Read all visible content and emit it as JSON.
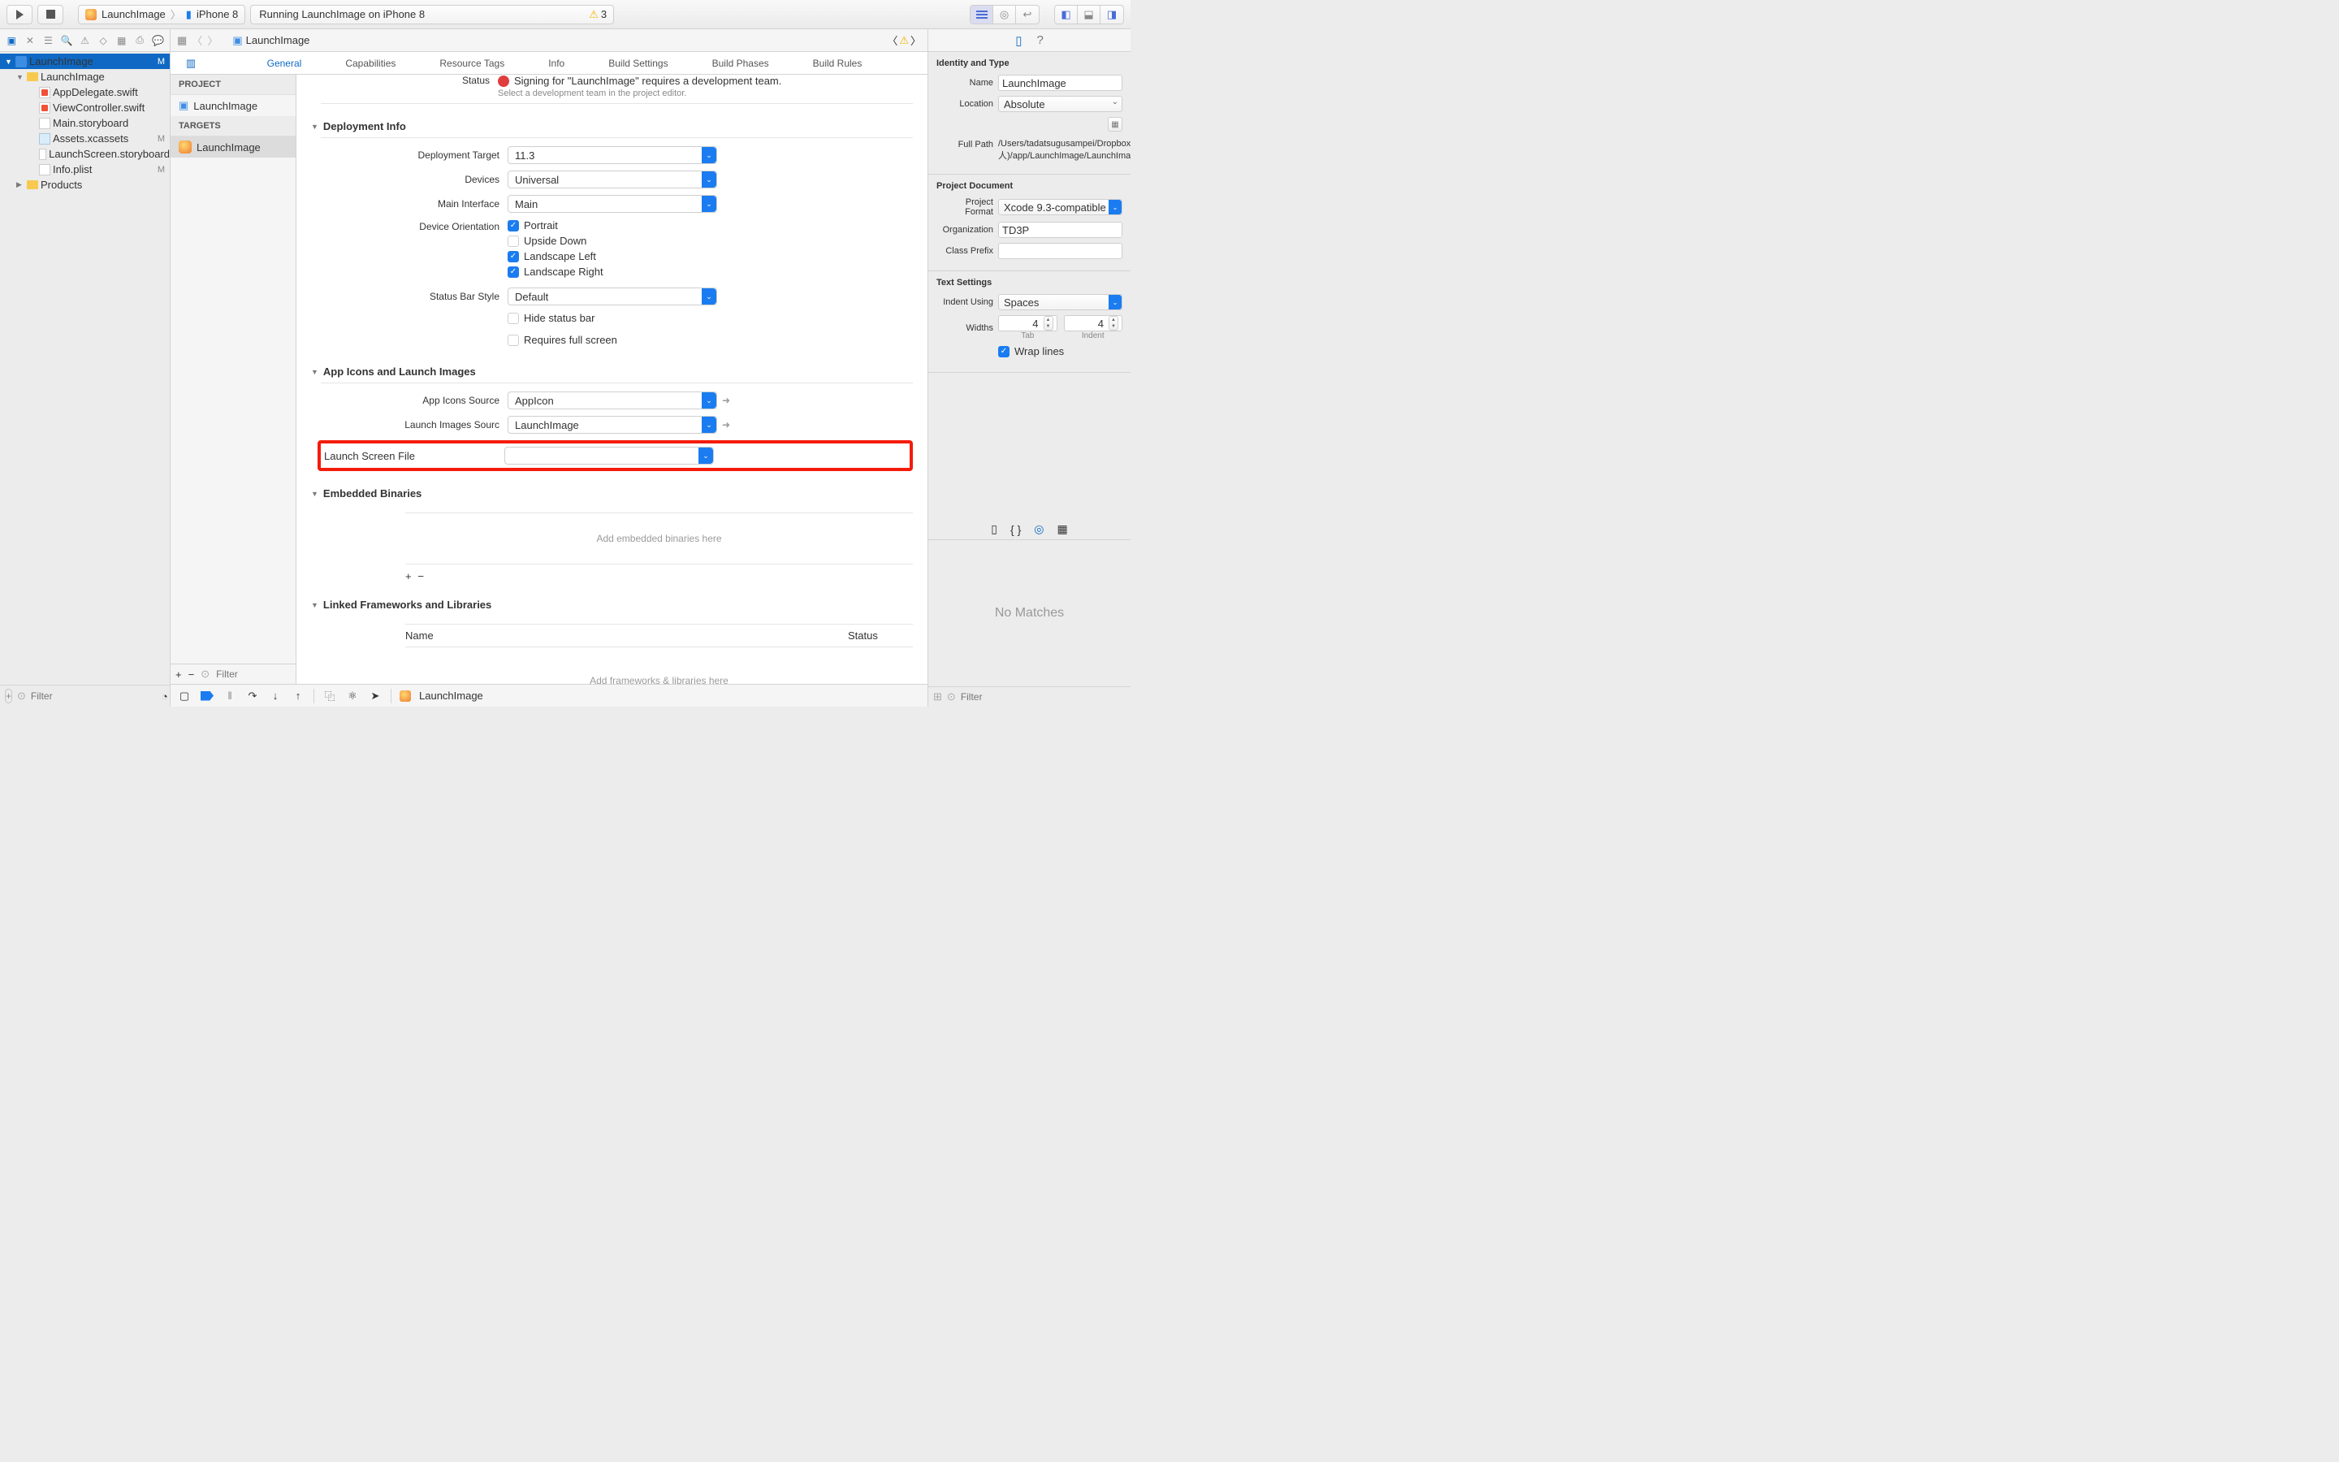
{
  "toolbar": {
    "scheme_app": "LaunchImage",
    "scheme_device": "iPhone 8",
    "activity_text": "Running LaunchImage on iPhone 8",
    "warning_count": "3"
  },
  "breadcrumb": {
    "item": "LaunchImage"
  },
  "navigator": {
    "root": "LaunchImage",
    "root_status": "M",
    "folder": "LaunchImage",
    "files": {
      "appdelegate": "AppDelegate.swift",
      "viewcontroller": "ViewController.swift",
      "mainsb": "Main.storyboard",
      "assets": "Assets.xcassets",
      "assets_status": "M",
      "launchsb": "LaunchScreen.storyboard",
      "plist": "Info.plist",
      "plist_status": "M"
    },
    "products": "Products",
    "filter_placeholder": "Filter"
  },
  "targets_panel": {
    "project_header": "PROJECT",
    "project_name": "LaunchImage",
    "targets_header": "TARGETS",
    "target_name": "LaunchImage",
    "filter_placeholder": "Filter"
  },
  "editor_tabs": {
    "general": "General",
    "capabilities": "Capabilities",
    "resource_tags": "Resource Tags",
    "info": "Info",
    "build_settings": "Build Settings",
    "build_phases": "Build Phases",
    "build_rules": "Build Rules"
  },
  "signing": {
    "status_label": "Status",
    "error_text": "Signing for \"LaunchImage\" requires a development team.",
    "hint_text": "Select a development team in the project editor."
  },
  "deployment": {
    "header": "Deployment Info",
    "target_label": "Deployment Target",
    "target_value": "11.3",
    "devices_label": "Devices",
    "devices_value": "Universal",
    "main_interface_label": "Main Interface",
    "main_interface_value": "Main",
    "orientation_label": "Device Orientation",
    "orientation": {
      "portrait": "Portrait",
      "upside_down": "Upside Down",
      "landscape_left": "Landscape Left",
      "landscape_right": "Landscape Right"
    },
    "status_bar_label": "Status Bar Style",
    "status_bar_value": "Default",
    "hide_status_bar": "Hide status bar",
    "requires_full_screen": "Requires full screen"
  },
  "app_icons": {
    "header": "App Icons and Launch Images",
    "icons_label": "App Icons Source",
    "icons_value": "AppIcon",
    "launch_images_label": "Launch Images Sourc",
    "launch_images_value": "LaunchImage",
    "launch_screen_label": "Launch Screen File",
    "launch_screen_value": ""
  },
  "embedded": {
    "header": "Embedded Binaries",
    "placeholder": "Add embedded binaries here"
  },
  "linked": {
    "header": "Linked Frameworks and Libraries",
    "col_name": "Name",
    "col_status": "Status",
    "placeholder": "Add frameworks & libraries here"
  },
  "inspector": {
    "identity_header": "Identity and Type",
    "name_label": "Name",
    "name_value": "LaunchImage",
    "location_label": "Location",
    "location_value": "Absolute",
    "fullpath_label": "Full Path",
    "fullpath_value": "/Users/tadatsugusampei/Dropbox (個人)/app/LaunchImage/LaunchImage.xcodeproj",
    "project_doc_header": "Project Document",
    "project_format_label": "Project Format",
    "project_format_value": "Xcode 9.3-compatible",
    "organization_label": "Organization",
    "organization_value": "TD3P",
    "class_prefix_label": "Class Prefix",
    "class_prefix_value": "",
    "text_settings_header": "Text Settings",
    "indent_using_label": "Indent Using",
    "indent_using_value": "Spaces",
    "widths_label": "Widths",
    "tab_value": "4",
    "tab_label": "Tab",
    "indent_value": "4",
    "indent_label": "Indent",
    "wrap_lines": "Wrap lines",
    "no_matches": "No Matches",
    "filter_placeholder": "Filter"
  },
  "debugbar": {
    "process": "LaunchImage"
  }
}
